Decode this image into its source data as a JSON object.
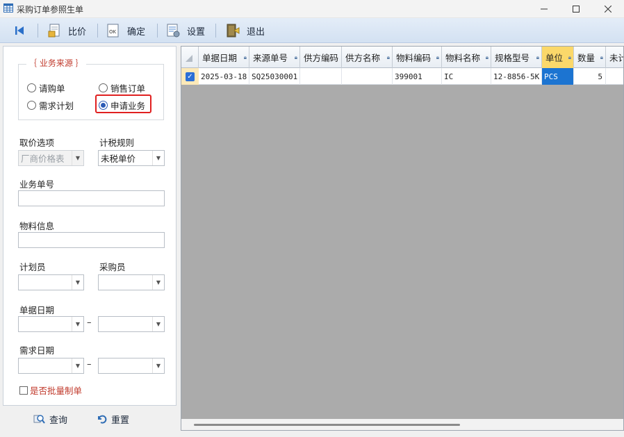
{
  "window": {
    "title": "采购订单参照生单"
  },
  "toolbar": {
    "first_icon": "first-record-icon",
    "compare_label": "比价",
    "confirm_label": "确定",
    "settings_label": "设置",
    "exit_label": "退出"
  },
  "source_group": {
    "title": "｛ 业务来源 ｝",
    "options": [
      {
        "label": "请购单",
        "checked": false
      },
      {
        "label": "销售订单",
        "checked": false
      },
      {
        "label": "需求计划",
        "checked": false
      },
      {
        "label": "申请业务",
        "checked": true
      }
    ]
  },
  "filters": {
    "price_option_label": "取价选项",
    "price_option_value": "厂商价格表",
    "tax_rule_label": "计税规则",
    "tax_rule_value": "未税单价",
    "business_no_label": "业务单号",
    "business_no_value": "",
    "material_info_label": "物料信息",
    "material_info_value": "",
    "planner_label": "计划员",
    "planner_value": "",
    "buyer_label": "采购员",
    "buyer_value": "",
    "doc_date_label": "单据日期",
    "doc_date_from": "",
    "doc_date_to": "",
    "need_date_label": "需求日期",
    "need_date_from": "",
    "need_date_to": "",
    "date_separator": "–",
    "batch_label": "是否批量制单",
    "batch_checked": false
  },
  "bottom": {
    "query_label": "查询",
    "reset_label": "重置"
  },
  "grid": {
    "columns": [
      "单据日期",
      "来源单号",
      "供方编码",
      "供方名称",
      "物料编码",
      "物料名称",
      "规格型号",
      "单位",
      "数量",
      "未计"
    ],
    "rows": [
      {
        "checked": true,
        "cells": [
          "2025-03-18",
          "SQ25030001",
          "",
          "",
          "399001",
          "IC",
          "12-8856-5K",
          "PCS",
          "5",
          ""
        ]
      }
    ]
  },
  "colors": {
    "accent": "#2b5bb6",
    "highlight_border": "#e02020",
    "selected_cell": "#1c74d1",
    "active_header": "#fbd86a",
    "group_title": "#c0392b"
  }
}
